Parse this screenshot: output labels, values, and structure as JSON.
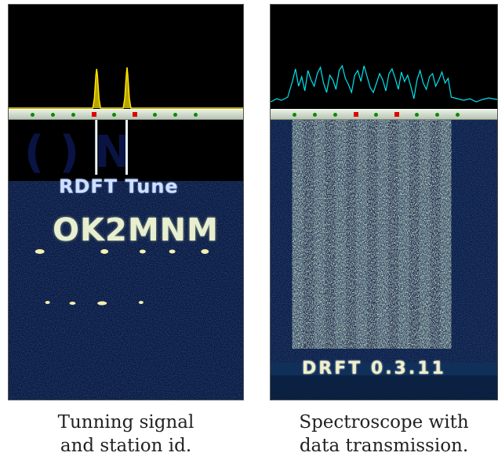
{
  "left_panel": {
    "waterfall_title": "RDFT Tune",
    "station_id": "OK2MNM",
    "caption_line1": "Tunning signal",
    "caption_line2": "and station id."
  },
  "right_panel": {
    "waterfall_footer": "DRFT 0.3.11",
    "caption_line1": "Spectroscope with",
    "caption_line2": "data transmission."
  },
  "colors": {
    "background": "#000000",
    "spectrum_left": "#ffe600",
    "spectrum_right": "#00e5f0",
    "waterfall_noise": "#0b1a4a",
    "signal": "#f4f0b0",
    "marker_green": "#0a8a00",
    "marker_red": "#e00000"
  },
  "tuning_markers": {
    "left": [
      "green",
      "green",
      "green",
      "red",
      "green",
      "red",
      "green",
      "green",
      "green"
    ],
    "right": [
      "green",
      "green",
      "green",
      "red",
      "green",
      "red",
      "green",
      "green",
      "green"
    ]
  }
}
